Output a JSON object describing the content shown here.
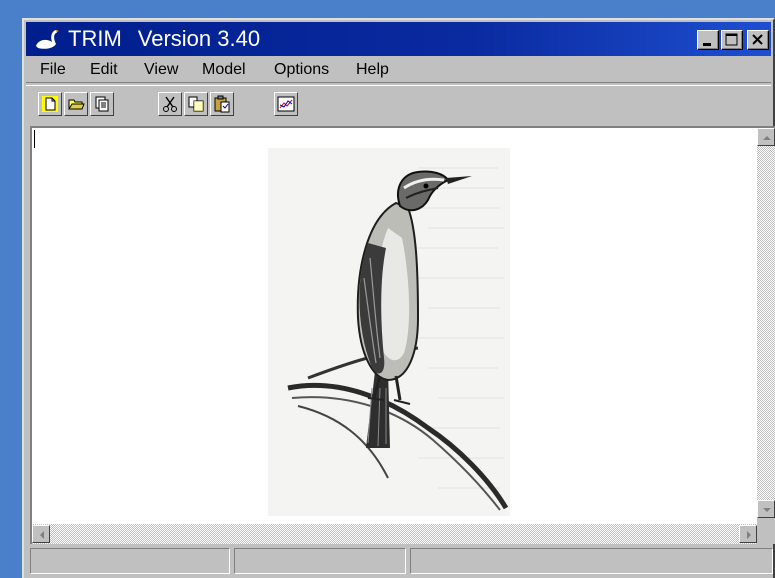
{
  "window": {
    "app_name": "TRIM",
    "version": "Version 3.40"
  },
  "title_buttons": [
    {
      "icon": "minimize-icon"
    },
    {
      "icon": "maximize-icon"
    },
    {
      "icon": "close-icon"
    }
  ],
  "menu": [
    "File",
    "Edit",
    "View",
    "Model",
    "Options",
    "Help"
  ],
  "toolbar": [
    {
      "icon": "new-file-icon"
    },
    {
      "icon": "open-folder-icon"
    },
    {
      "icon": "copy-pages-icon"
    },
    {
      "icon": "cut-icon"
    },
    {
      "icon": "copy-icon"
    },
    {
      "icon": "paste-icon"
    },
    {
      "icon": "chart-icon"
    }
  ],
  "client": {
    "image_subject": "pencil drawing of a warbler perched on a reed"
  },
  "statusbar": {
    "panel_1": "",
    "panel_2": "",
    "panel_3": ""
  },
  "colors": {
    "desktop": "#4a7fc9",
    "titlebar_start": "#001e8c",
    "titlebar_end": "#1e4fd0",
    "face": "#c0c0c0"
  }
}
